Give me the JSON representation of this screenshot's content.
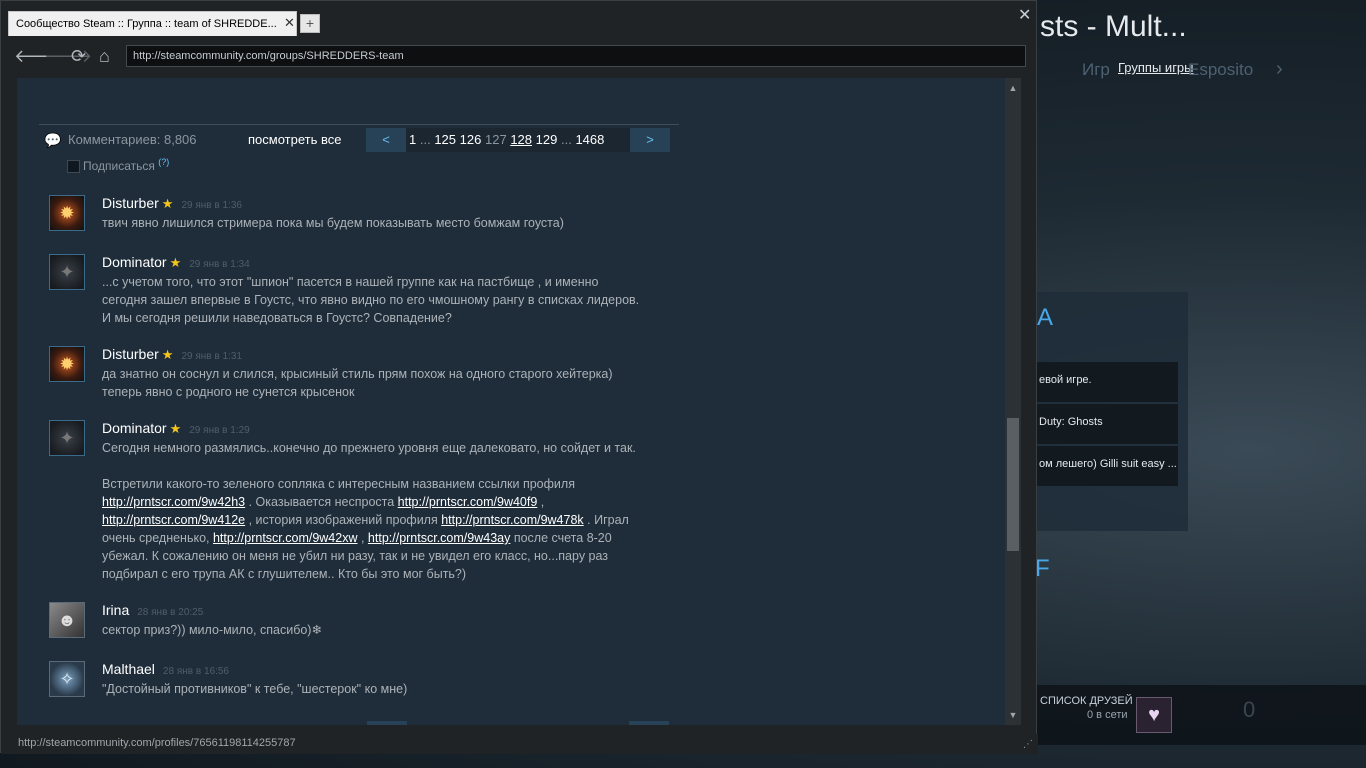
{
  "background": {
    "title": "sts - Mult...",
    "nav_games_partial": "Игр",
    "nav_game_groups": "Группы игры",
    "nav_esposito": "Esposito",
    "nav_arrow": "›",
    "panel_letter": "A",
    "rows": [
      "евой игре.",
      "Duty: Ghosts",
      "ом лешего) Gilli suit easy ..."
    ],
    "panel_letter2": "F",
    "friends_label": "СПИСОК ДРУЗЕЙ",
    "friends_online": "0 в сети",
    "zero": "0"
  },
  "browser": {
    "tab_title": "Сообщество Steam :: Группа :: team of SHREDDE...",
    "tab_close": "✕",
    "new_tab": "+",
    "window_close": "✕",
    "url": "http://steamcommunity.com/groups/SHREDDERS-team",
    "status_url": "http://steamcommunity.com/profiles/76561198114255787"
  },
  "comments_header": {
    "count_text": "Комментариев: 8,806",
    "view_all": "посмотреть все",
    "prev": "<",
    "next": ">",
    "pages": {
      "p1": "1",
      "dots1": "...",
      "p125": "125",
      "p126": "126",
      "p127": "127",
      "p128": "128",
      "p129": "129",
      "dots2": "...",
      "p1468": "1468"
    },
    "subscribe": "Подписаться",
    "subscribe_help": "(?)"
  },
  "comments": [
    {
      "author": "Disturber",
      "time": "29 янв в 1:36",
      "text": "твич явно лишился стримера пока мы будем показывать место бомжам гоуста)"
    },
    {
      "author": "Dominator",
      "time": "29 янв в 1:34",
      "line1": "...с учетом того, что этот \"шпион\" пасется в нашей группе как на пастбище , и именно",
      "line2": "сегодня зашел впервые в Гоустс, что явно видно по его чмошному рангу в списках лидеров.",
      "line3": "И мы сегодня решили наведоваться в Гоустс? Совпадение?"
    },
    {
      "author": "Disturber",
      "time": "29 янв в 1:31",
      "line1": "да знатно он соснул и слился, крысиный стиль прям похож на одного старого хейтерка)",
      "line2": "теперь явно с родного не сунется крысенок"
    },
    {
      "author": "Dominator",
      "time": "29 янв в 1:29",
      "line1": "Сегодня немного размялись..конечно до прежнего уровня еще далековато, но сойдет и так.",
      "line2": "Встретили какого-то зеленого сопляка с интересным названием ссылки профиля",
      "link1": "http://prntscr.com/9w42h3",
      "t1": " . Оказывается неспроста ",
      "link2": "http://prntscr.com/9w40f9",
      "t2": " ,",
      "link3": "http://prntscr.com/9w412e",
      "t3": " , история изображений профиля ",
      "link4": "http://prntscr.com/9w478k",
      "t4": " . Играл",
      "t5": "очень средненько, ",
      "link5": "http://prntscr.com/9w42xw",
      "t6": " , ",
      "link6": "http://prntscr.com/9w43ay",
      "t7": " после счета 8-20",
      "line_last1": "убежал. К сожалению он меня не убил ни разу, так и не увидел его класс, но...пару раз",
      "line_last2": "подбирал с его трупа АК с глушителем.. Кто бы это мог быть?)"
    },
    {
      "author": "Irina",
      "time": "28 янв в 20:25",
      "text": "сектор приз?)) мило-мило, спасибо)❄"
    },
    {
      "author": "Malthael",
      "time": "28 янв в 16:56",
      "text": "\"Достойный противников\" к тебе, \"шестерок\" ко мне)"
    }
  ],
  "colors": {
    "link_blue": "#66c0f4",
    "content_bg": "#1f2d3a",
    "star": "#f5c518"
  }
}
